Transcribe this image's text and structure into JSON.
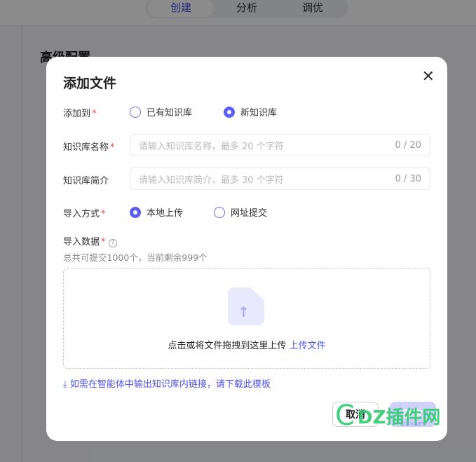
{
  "background": {
    "tabs": [
      "创建",
      "分析",
      "调优"
    ],
    "active_tab": 0,
    "section_title": "高级配置"
  },
  "modal": {
    "title": "添加文件",
    "add_to": {
      "label": "添加到",
      "options": [
        "已有知识库",
        "新知识库"
      ],
      "selected": 1
    },
    "kb_name": {
      "label": "知识库名称",
      "placeholder": "请输入知识库名称，最多 20 个字符",
      "counter": "0 / 20"
    },
    "kb_desc": {
      "label": "知识库简介",
      "placeholder": "请输入知识库简介，最多 30  个字符",
      "counter": "0 / 30"
    },
    "import_method": {
      "label": "导入方式",
      "options": [
        "本地上传",
        "网址提交"
      ],
      "selected": 0
    },
    "import_data": {
      "label": "导入数据",
      "hint": "总共可提交1000个，当前剩余999个",
      "drop_text": "点击或将文件拖拽到这里上传",
      "upload_link": "上传文件"
    },
    "template_link": "如需在智能体中输出知识库内链接，请下载此模板",
    "cancel": "取消",
    "confirm": "确定"
  },
  "watermark": {
    "text": "DZ插件网",
    "sub": "DZ-X.NET"
  },
  "colors": {
    "accent": "#4d53e8",
    "required": "#f04b4b"
  }
}
